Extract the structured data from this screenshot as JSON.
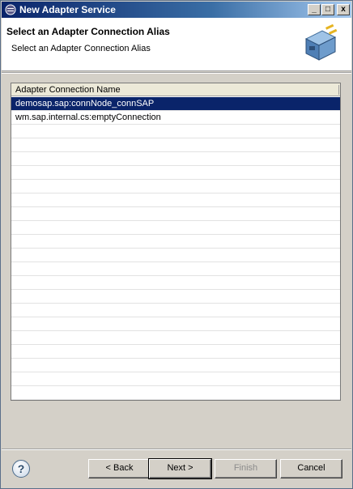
{
  "window": {
    "title": "New Adapter Service",
    "controls": {
      "minimize": "_",
      "maximize": "□",
      "close": "x"
    }
  },
  "header": {
    "title": "Select an Adapter Connection Alias",
    "subtitle": "Select an Adapter Connection Alias",
    "icon": "adapter-connection-icon"
  },
  "table": {
    "columns": [
      "Adapter Connection Name"
    ],
    "rows": [
      {
        "name": "demosap.sap:connNode_connSAP",
        "selected": true
      },
      {
        "name": "wm.sap.internal.cs:emptyConnection",
        "selected": false
      },
      {
        "name": "",
        "selected": false
      },
      {
        "name": "",
        "selected": false
      },
      {
        "name": "",
        "selected": false
      },
      {
        "name": "",
        "selected": false
      },
      {
        "name": "",
        "selected": false
      },
      {
        "name": "",
        "selected": false
      },
      {
        "name": "",
        "selected": false
      },
      {
        "name": "",
        "selected": false
      },
      {
        "name": "",
        "selected": false
      },
      {
        "name": "",
        "selected": false
      },
      {
        "name": "",
        "selected": false
      },
      {
        "name": "",
        "selected": false
      },
      {
        "name": "",
        "selected": false
      },
      {
        "name": "",
        "selected": false
      },
      {
        "name": "",
        "selected": false
      },
      {
        "name": "",
        "selected": false
      },
      {
        "name": "",
        "selected": false
      },
      {
        "name": "",
        "selected": false
      },
      {
        "name": "",
        "selected": false
      },
      {
        "name": "",
        "selected": false
      }
    ]
  },
  "footer": {
    "help_label": "?",
    "back_label": "< Back",
    "next_label": "Next >",
    "finish_label": "Finish",
    "cancel_label": "Cancel",
    "finish_enabled": false
  },
  "colors": {
    "selection": "#0a246a",
    "titlebar_start": "#0a246a",
    "titlebar_end": "#a6caf0"
  }
}
